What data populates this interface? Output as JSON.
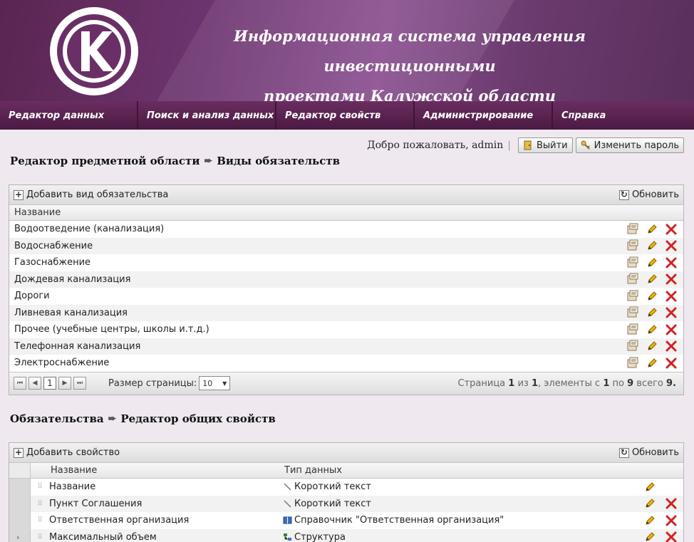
{
  "header": {
    "title_line1": "Информационная система управления инвестиционными",
    "title_line2": "проектами Калужской области"
  },
  "nav": [
    {
      "label": "Редактор данных"
    },
    {
      "label": "Поиск и анализ данных"
    },
    {
      "label": "Редактор свойств"
    },
    {
      "label": "Администрирование"
    },
    {
      "label": "Справка"
    }
  ],
  "user": {
    "welcome": "Добро пожаловать, admin",
    "separator": "|",
    "logout_label": "Выйти",
    "change_password_label": "Изменить пароль"
  },
  "section1": {
    "breadcrumb_part1": "Редактор предметной области",
    "breadcrumb_part2": "Виды обязательств",
    "add_label": "Добавить вид обязательства",
    "refresh_label": "Обновить",
    "column_name": "Название",
    "rows": [
      "Водоотведение (канализация)",
      "Водоснабжение",
      "Газоснабжение",
      "Дождевая канализация",
      "Дороги",
      "Ливневая канализация",
      "Прочее (учебные центры, школы и.т.д.)",
      "Телефонная канализация",
      "Электроснабжение"
    ],
    "pager": {
      "current_page": "1",
      "page_size_label": "Размер страницы:",
      "page_size_value": "10",
      "info_prefix": "Страница",
      "info_page": "1",
      "info_of": "из",
      "info_total_pages": "1",
      "info_items": ", элементы с",
      "info_from": "1",
      "info_to_word": "по",
      "info_to": "9",
      "info_total_word": "всего",
      "info_total": "9."
    }
  },
  "section2": {
    "breadcrumb_part1": "Обязательства",
    "breadcrumb_part2": "Редактор общих свойств",
    "add_label": "Добавить свойство",
    "refresh_label": "Обновить",
    "column_name": "Название",
    "column_type": "Тип данных",
    "rows": [
      {
        "name": "Название",
        "type": "Короткий текст",
        "type_icon": "text-icon",
        "deletable": false
      },
      {
        "name": "Пункт Соглашения",
        "type": "Короткий текст",
        "type_icon": "text-icon",
        "deletable": true
      },
      {
        "name": "Ответственная организация",
        "type": "Справочник \"Ответственная организация\"",
        "type_icon": "book-icon",
        "deletable": true
      },
      {
        "name": "Максимальный объем",
        "type": "Структура",
        "type_icon": "structure-icon",
        "deletable": true
      }
    ]
  },
  "colors": {
    "header_purple": "#6d3570",
    "nav_purple": "#522048",
    "delete_red": "#d42020",
    "edit_yellow": "#f0b400"
  }
}
